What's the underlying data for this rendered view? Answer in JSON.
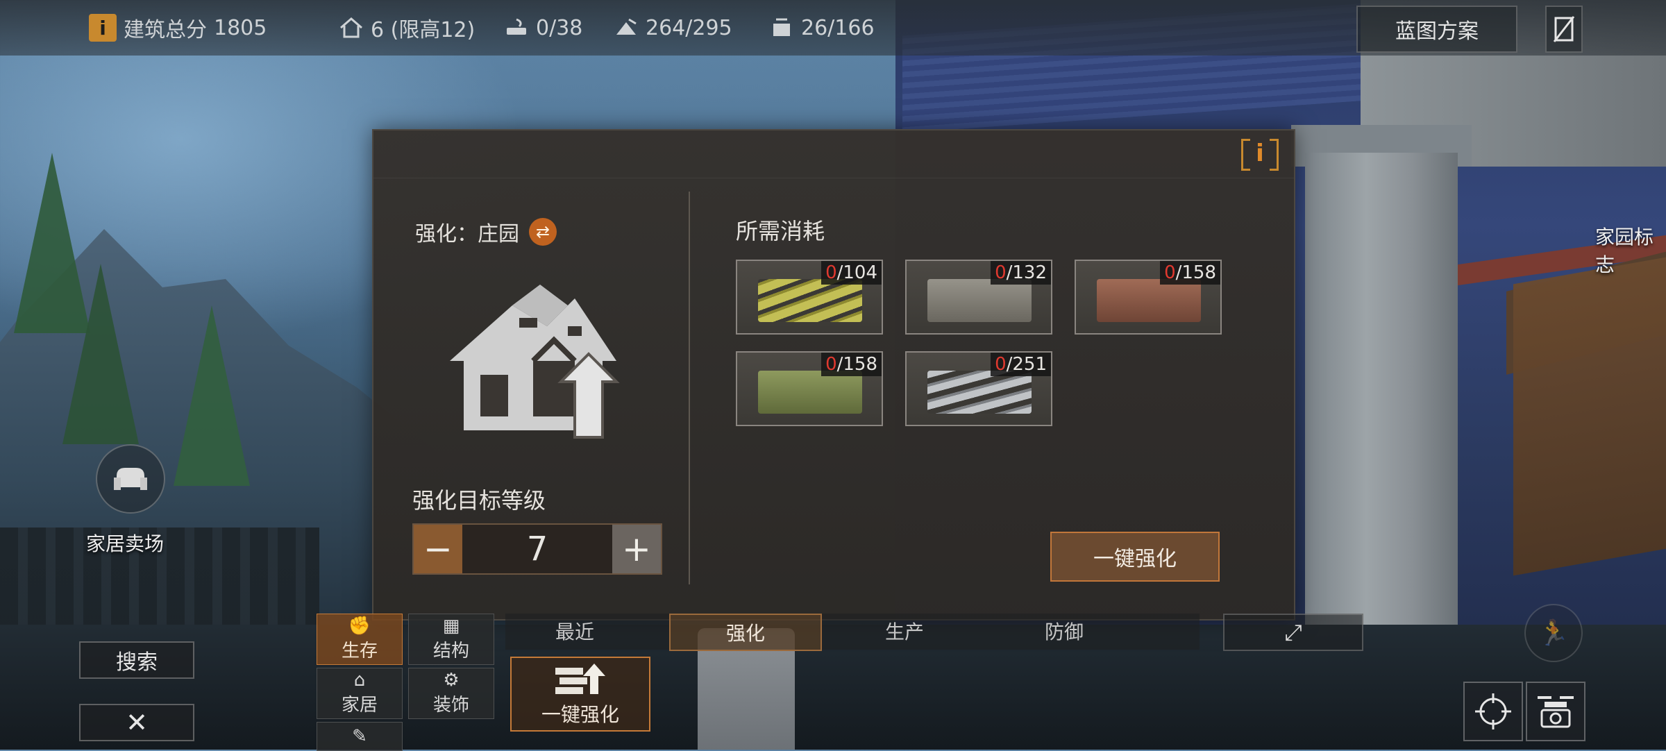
{
  "hud": {
    "score_label": "建筑总分",
    "score_value": "1805",
    "floors": "6 (限高12)",
    "stat_a": "0/38",
    "stat_b": "264/295",
    "stat_c": "26/166",
    "blueprint_label": "蓝图方案"
  },
  "modal": {
    "target_label": "强化：庄园",
    "level_label": "强化目标等级",
    "level_value": "7",
    "minus": "−",
    "plus": "+",
    "cost_title": "所需消耗",
    "upgrade_all_label": "一键强化",
    "materials": [
      {
        "name": "wood-planks",
        "have": "0",
        "need": "/104",
        "color": "#b6b24a"
      },
      {
        "name": "stone-block",
        "have": "0",
        "need": "/132",
        "color": "#7e7b72"
      },
      {
        "name": "brick-block",
        "have": "0",
        "need": "/158",
        "color": "#8a5a48"
      },
      {
        "name": "concrete-block",
        "have": "0",
        "need": "/158",
        "color": "#7f8a52"
      },
      {
        "name": "steel-bars",
        "have": "0",
        "need": "/251",
        "color": "#a4a7ab"
      }
    ]
  },
  "build_menu": {
    "tabs": [
      "最近",
      "强化",
      "生产",
      "防御"
    ],
    "active_tab": "强化",
    "categories": {
      "survival": "生存",
      "structure": "结构",
      "furniture": "家居",
      "decoration": "装饰"
    },
    "big_upgrade_label": "一键强化"
  },
  "left": {
    "market_label": "家居卖场",
    "search_label": "搜索",
    "close_label": "✕"
  },
  "right": {
    "home_sign_label": "家园标志"
  },
  "colors": {
    "accent": "#c57a38",
    "info": "#c8892e",
    "shortage": "#e0392f"
  }
}
